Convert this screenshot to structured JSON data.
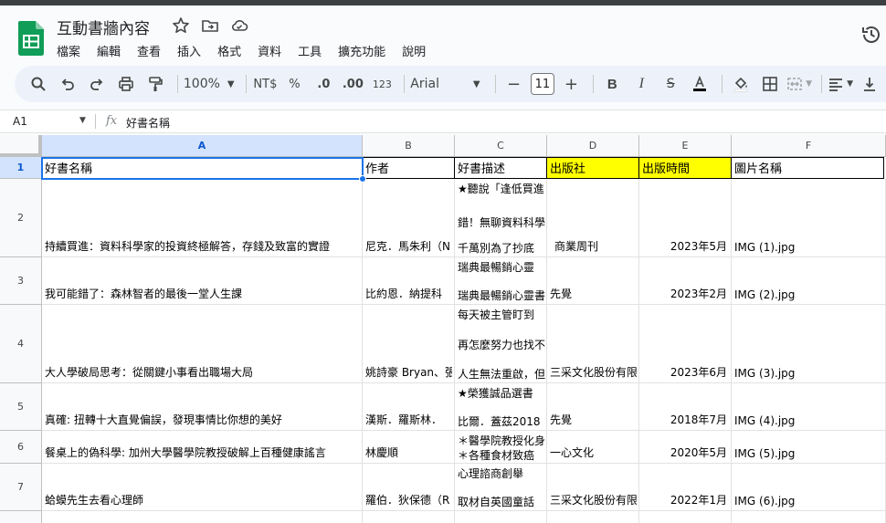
{
  "doc": {
    "title": "互動書牆內容"
  },
  "menu": [
    "檔案",
    "編輯",
    "查看",
    "插入",
    "格式",
    "資料",
    "工具",
    "擴充功能",
    "說明"
  ],
  "toolbar": {
    "zoom": "100%",
    "currency": "NT$",
    "percent": "%",
    "decrease_decimal": ".0",
    "increase_decimal": ".00",
    "number_format": "123",
    "font": "Arial",
    "font_size": "11"
  },
  "formula_bar": {
    "cell_ref": "A1",
    "fx": "fx",
    "value": "好書名稱"
  },
  "columns": [
    "A",
    "B",
    "C",
    "D",
    "E",
    "F"
  ],
  "rows": [
    "1",
    "2",
    "3",
    "4",
    "5",
    "6",
    "7"
  ],
  "sheet": {
    "header": [
      "好書名稱",
      "作者",
      "好書描述",
      "出版社",
      "出版時間",
      "圖片名稱"
    ],
    "data": [
      {
        "title": "持續買進：資料科學家的投資終極解答，存錢及致富的實證",
        "author": "尼克．馬朱利（N",
        "desc": [
          "★聽說「逢低買進",
          "錯！無聊資料科學",
          "千萬別為了抄底"
        ],
        "publisher": "商業周刊",
        "date": "2023年5月",
        "image": "IMG (1).jpg"
      },
      {
        "title": "我可能錯了：森林智者的最後一堂人生課",
        "author": "比約恩．納提科",
        "desc": [
          "瑞典最暢銷心靈",
          "瑞典最暢銷心靈書"
        ],
        "publisher": "先覺",
        "date": "2023年2月",
        "image": "IMG (2).jpg"
      },
      {
        "title": "大人學破局思考：從關鍵小事看出職場大局",
        "author": "姚詩豪 Bryan、張",
        "desc": [
          "每天被主管盯到",
          "再怎麼努力也找不",
          "人生無法重啟，但"
        ],
        "publisher": "三采文化股份有限",
        "date": "2023年6月",
        "image": "IMG (3).jpg"
      },
      {
        "title": "真確: 扭轉十大直覺偏誤，發現事情比你想的美好",
        "author": "漢斯．羅斯林．",
        "desc": [
          "★榮獲誠品選書",
          "比爾．蓋茲2018"
        ],
        "publisher": "先覺",
        "date": "2018年7月",
        "image": "IMG (4).jpg"
      },
      {
        "title": "餐桌上的偽科學: 加州大學醫學院教授破解上百種健康謠言",
        "author": "林慶順",
        "desc": [
          "＊醫學院教授化身",
          "＊各種食材致癌"
        ],
        "publisher": "一心文化",
        "date": "2020年5月",
        "image": "IMG (5).jpg"
      },
      {
        "title": "蛤蟆先生去看心理師",
        "author": "羅伯．狄保德（R",
        "desc": [
          "心理諮商創舉",
          "取材自英國童話"
        ],
        "publisher": "三采文化股份有限",
        "date": "2022年1月",
        "image": "IMG (6).jpg"
      }
    ]
  },
  "colors": {
    "accent": "#1a73e8",
    "highlight": "#ffff00",
    "sheets_green": "#0f9d58"
  }
}
